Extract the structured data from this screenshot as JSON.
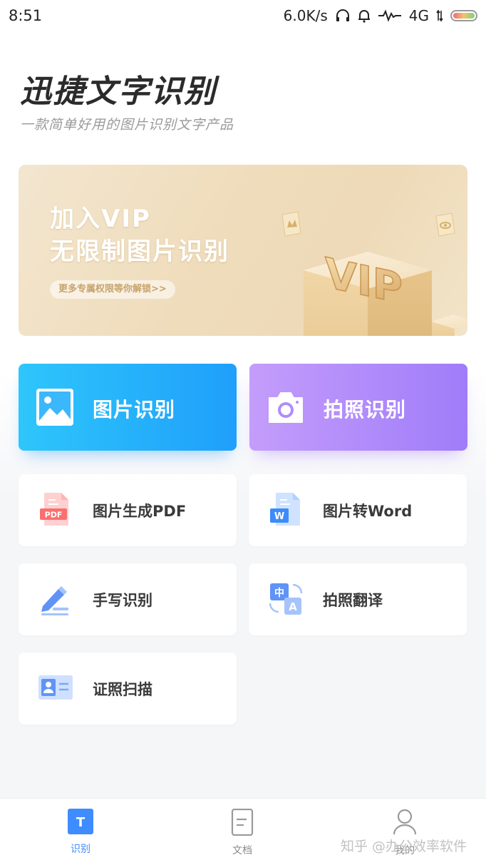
{
  "status_bar": {
    "time": "8:51",
    "net_speed": "6.0K/s",
    "network": "4G",
    "icons": [
      "headphones-icon",
      "bell-icon",
      "signal-activity-icon",
      "data-arrows-icon",
      "battery-icon"
    ]
  },
  "header": {
    "title": "迅捷文字识别",
    "subtitle": "一款简单好用的图片识别文字产品"
  },
  "banner": {
    "line1": "加入VIP",
    "line2": "无限制图片识别",
    "pill": "更多专属权限等你解锁>>",
    "art_text": "VIP"
  },
  "features": {
    "primary": [
      {
        "label": "图片识别",
        "icon": "image-icon"
      },
      {
        "label": "拍照识别",
        "icon": "camera-icon"
      }
    ],
    "secondary": [
      {
        "label": "图片生成PDF",
        "icon": "pdf-file-icon"
      },
      {
        "label": "图片转Word",
        "icon": "word-file-icon"
      },
      {
        "label": "手写识别",
        "icon": "pen-icon"
      },
      {
        "label": "拍照翻译",
        "icon": "translate-icon"
      },
      {
        "label": "证照扫描",
        "icon": "id-card-icon"
      }
    ]
  },
  "bottom_nav": {
    "items": [
      {
        "label": "识别",
        "icon": "t-text-icon",
        "active": true
      },
      {
        "label": "文档",
        "icon": "document-icon",
        "active": false
      },
      {
        "label": "我的",
        "icon": "user-icon",
        "active": false
      }
    ],
    "icon_t": "T"
  },
  "watermark": "知乎 @办公效率软件",
  "colors": {
    "primary_blue": "#1f9ffb",
    "primary_purple": "#a07cf9",
    "nav_active": "#3f8cff",
    "banner_gold": "#efdcbb"
  }
}
